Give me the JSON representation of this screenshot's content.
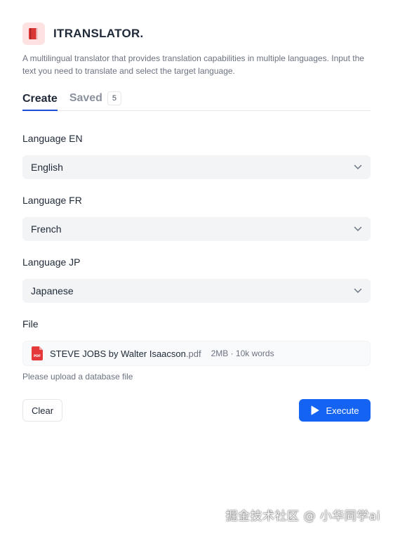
{
  "app": {
    "title": "ITRANSLATOR.",
    "logo_icon": "book-icon",
    "description": "A multilingual translator that provides translation capabilities in multiple languages. Input the text you need to translate and select the target language."
  },
  "tabs": [
    {
      "label": "Create",
      "active": true
    },
    {
      "label": "Saved",
      "count": "5",
      "active": false
    }
  ],
  "fields": {
    "lang_en": {
      "label": "Language EN",
      "value": "English"
    },
    "lang_fr": {
      "label": "Language FR",
      "value": "French"
    },
    "lang_jp": {
      "label": "Language JP",
      "value": "Japanese"
    },
    "file": {
      "label": "File",
      "name": "STEVE JOBS by Walter Isaacson",
      "ext": ".pdf",
      "meta": "2MB · 10k words",
      "hint": "Please upload a database file"
    }
  },
  "actions": {
    "clear_label": "Clear",
    "execute_label": "Execute"
  },
  "watermark": "掘金技术社区 @ 小华同学ai",
  "colors": {
    "accent": "#1463f3",
    "tab_underline": "#1d4ed8",
    "logo_bg": "#fde2e2",
    "pdf_red": "#e5383b"
  }
}
